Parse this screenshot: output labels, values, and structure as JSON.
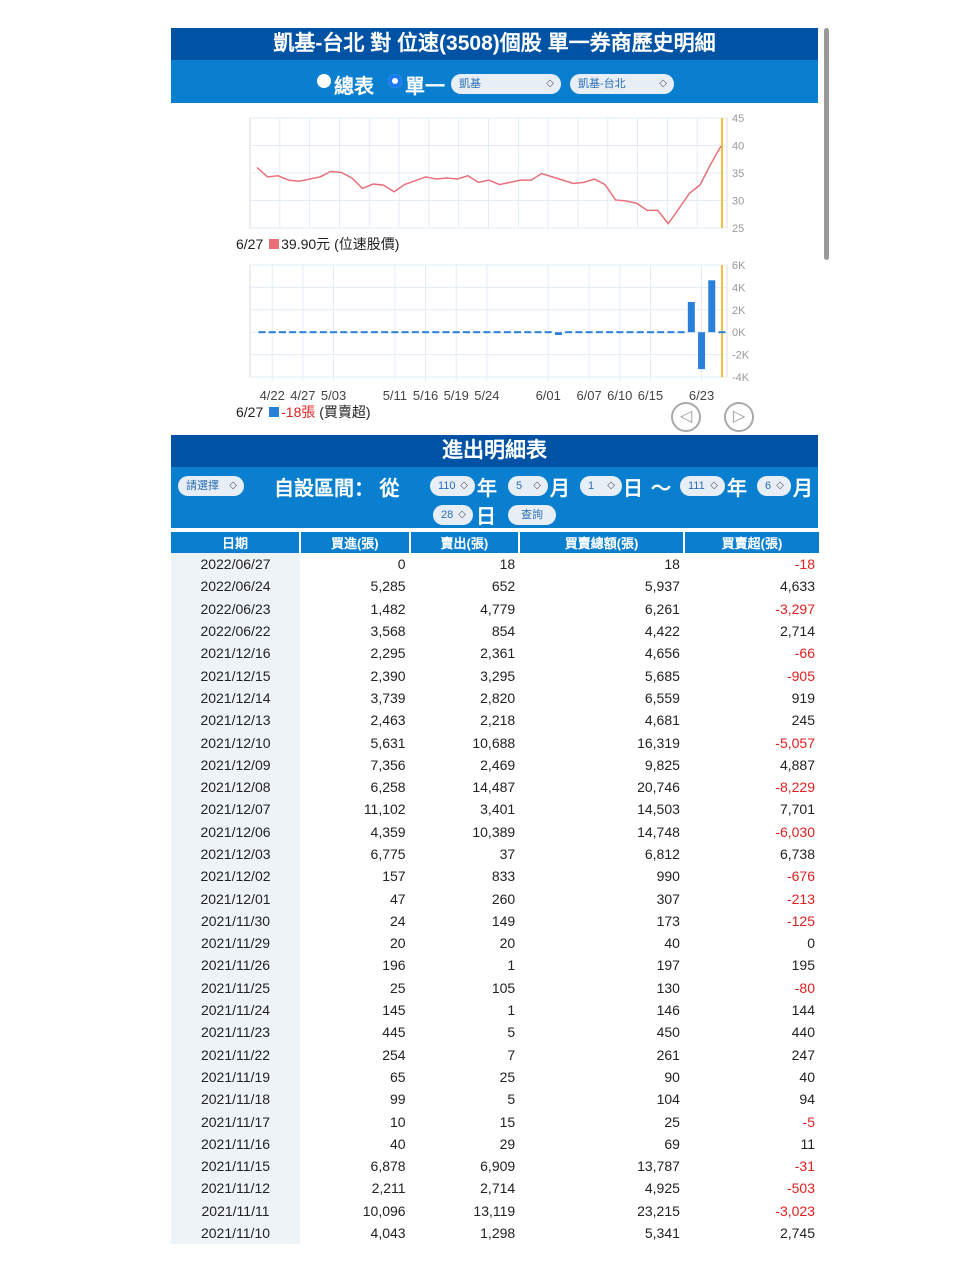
{
  "header": {
    "title": "凱基-台北 對 位速(3508)個股 單一券商歷史明細",
    "radio_all": "總表",
    "radio_single": "單一",
    "broker_select": "凱基",
    "branch_select": "凱基-台北"
  },
  "price_chart": {
    "type": "line",
    "y_ticks": [
      "45",
      "40",
      "35",
      "30",
      "25"
    ],
    "ylim": [
      25,
      45
    ],
    "color": "#e8707a",
    "values": [
      36,
      34.3,
      34.5,
      33.7,
      33.5,
      33.9,
      34.3,
      35.3,
      35.1,
      34.1,
      32.2,
      33,
      32.8,
      31.6,
      32.9,
      33.6,
      34.3,
      33.9,
      34.1,
      33.9,
      34.5,
      33.3,
      33.7,
      32.9,
      33.3,
      33.7,
      33.7,
      34.9,
      34.3,
      33.7,
      33.1,
      33.3,
      33.9,
      32.9,
      30.1,
      29.9,
      29.5,
      28.2,
      28.2,
      25.8,
      28.5,
      31.3,
      32.8,
      36.5,
      39.9
    ],
    "legend_date": "6/27",
    "legend_value": "39.90元",
    "legend_name": "(位速股價)"
  },
  "chart_data": {
    "type": "bar",
    "y_ticks": [
      "6K",
      "4K",
      "2K",
      "0K",
      "-2K",
      "-4K"
    ],
    "ylim": [
      -4000,
      6000
    ],
    "color": "#2a7fd8",
    "x_ticks": [
      "4/22",
      "4/27",
      "5/03",
      "5/11",
      "5/16",
      "5/19",
      "5/24",
      "6/01",
      "6/07",
      "6/10",
      "6/15",
      "6/23"
    ],
    "x_tick_index": [
      1,
      4,
      7,
      13,
      16,
      19,
      22,
      28,
      32,
      35,
      38,
      43
    ],
    "values": [
      0,
      30,
      0,
      0,
      120,
      -60,
      -150,
      0,
      30,
      30,
      0,
      0,
      0,
      40,
      0,
      -60,
      130,
      -80,
      120,
      -80,
      30,
      0,
      30,
      -60,
      50,
      -80,
      -80,
      0,
      0,
      -250,
      0,
      0,
      0,
      0,
      -60,
      -60,
      0,
      -150,
      0,
      30,
      30,
      30,
      2700,
      -3297,
      4633,
      -18
    ],
    "legend_date": "6/27",
    "legend_value": "-18張",
    "legend_name": "(買賣超)"
  },
  "detail": {
    "title": "進出明細表",
    "preset_select": "請選擇",
    "range_label": "自設區間： 從",
    "from_year": "110",
    "year": "年",
    "from_month": "5",
    "month": "月",
    "from_day": "1",
    "day": "日",
    "tilde": "～",
    "to_year": "111",
    "to_month": "6",
    "to_day": "28",
    "query": "查詢"
  },
  "table": {
    "headers": [
      "日期",
      "買進(張)",
      "賣出(張)",
      "買賣總額(張)",
      "買賣超(張)"
    ],
    "rows": [
      [
        "2022/06/27",
        "0",
        "18",
        "18",
        "-18"
      ],
      [
        "2022/06/24",
        "5,285",
        "652",
        "5,937",
        "4,633"
      ],
      [
        "2022/06/23",
        "1,482",
        "4,779",
        "6,261",
        "-3,297"
      ],
      [
        "2022/06/22",
        "3,568",
        "854",
        "4,422",
        "2,714"
      ],
      [
        "2021/12/16",
        "2,295",
        "2,361",
        "4,656",
        "-66"
      ],
      [
        "2021/12/15",
        "2,390",
        "3,295",
        "5,685",
        "-905"
      ],
      [
        "2021/12/14",
        "3,739",
        "2,820",
        "6,559",
        "919"
      ],
      [
        "2021/12/13",
        "2,463",
        "2,218",
        "4,681",
        "245"
      ],
      [
        "2021/12/10",
        "5,631",
        "10,688",
        "16,319",
        "-5,057"
      ],
      [
        "2021/12/09",
        "7,356",
        "2,469",
        "9,825",
        "4,887"
      ],
      [
        "2021/12/08",
        "6,258",
        "14,487",
        "20,746",
        "-8,229"
      ],
      [
        "2021/12/07",
        "11,102",
        "3,401",
        "14,503",
        "7,701"
      ],
      [
        "2021/12/06",
        "4,359",
        "10,389",
        "14,748",
        "-6,030"
      ],
      [
        "2021/12/03",
        "6,775",
        "37",
        "6,812",
        "6,738"
      ],
      [
        "2021/12/02",
        "157",
        "833",
        "990",
        "-676"
      ],
      [
        "2021/12/01",
        "47",
        "260",
        "307",
        "-213"
      ],
      [
        "2021/11/30",
        "24",
        "149",
        "173",
        "-125"
      ],
      [
        "2021/11/29",
        "20",
        "20",
        "40",
        "0"
      ],
      [
        "2021/11/26",
        "196",
        "1",
        "197",
        "195"
      ],
      [
        "2021/11/25",
        "25",
        "105",
        "130",
        "-80"
      ],
      [
        "2021/11/24",
        "145",
        "1",
        "146",
        "144"
      ],
      [
        "2021/11/23",
        "445",
        "5",
        "450",
        "440"
      ],
      [
        "2021/11/22",
        "254",
        "7",
        "261",
        "247"
      ],
      [
        "2021/11/19",
        "65",
        "25",
        "90",
        "40"
      ],
      [
        "2021/11/18",
        "99",
        "5",
        "104",
        "94"
      ],
      [
        "2021/11/17",
        "10",
        "15",
        "25",
        "-5"
      ],
      [
        "2021/11/16",
        "40",
        "29",
        "69",
        "11"
      ],
      [
        "2021/11/15",
        "6,878",
        "6,909",
        "13,787",
        "-31"
      ],
      [
        "2021/11/12",
        "2,211",
        "2,714",
        "4,925",
        "-503"
      ],
      [
        "2021/11/11",
        "10,096",
        "13,119",
        "23,215",
        "-3,023"
      ],
      [
        "2021/11/10",
        "4,043",
        "1,298",
        "5,341",
        "2,745"
      ]
    ]
  }
}
